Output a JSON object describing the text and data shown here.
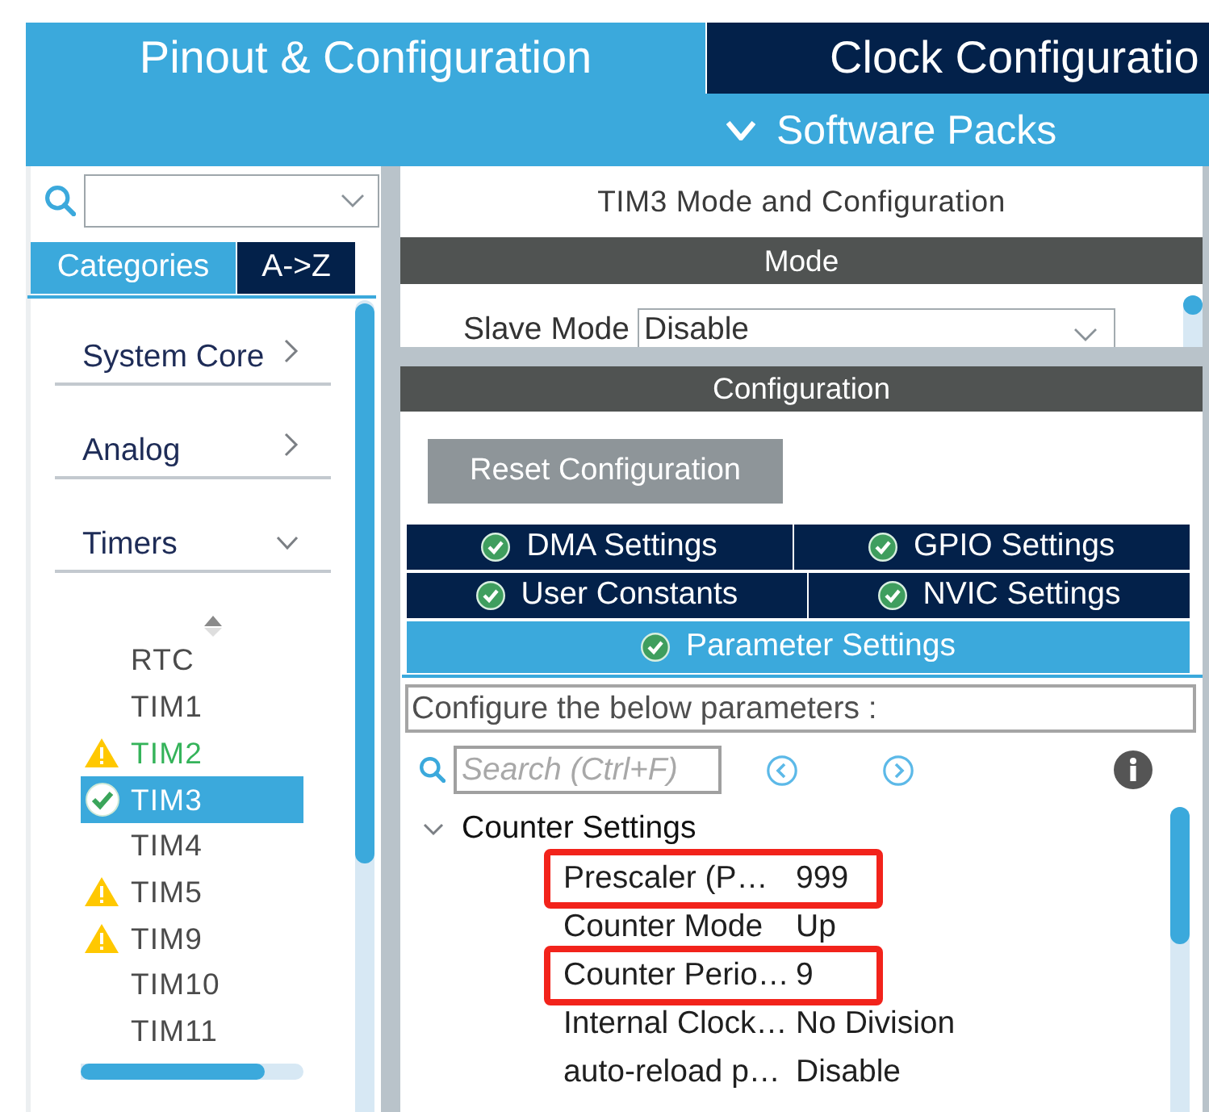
{
  "header": {
    "tabs": [
      {
        "label": "Pinout & Configuration",
        "selected": true
      },
      {
        "label": "Clock Configuratio",
        "selected": false
      }
    ],
    "software_packs": "Software Packs"
  },
  "sidebar": {
    "view_tabs": [
      {
        "label": "Categories",
        "selected": true
      },
      {
        "label": "A->Z",
        "selected": false
      }
    ],
    "categories": [
      {
        "label": "System Core",
        "expanded": false
      },
      {
        "label": "Analog",
        "expanded": false
      },
      {
        "label": "Timers",
        "expanded": true,
        "children": [
          {
            "label": "RTC",
            "kind": "plain",
            "selected": false
          },
          {
            "label": "TIM1",
            "kind": "plain",
            "selected": false
          },
          {
            "label": "TIM2",
            "kind": "partial",
            "selected": false
          },
          {
            "label": "TIM3",
            "kind": "done",
            "selected": true
          },
          {
            "label": "TIM4",
            "kind": "plain",
            "selected": false
          },
          {
            "label": "TIM5",
            "kind": "warning",
            "selected": false
          },
          {
            "label": "TIM9",
            "kind": "warning",
            "selected": false
          },
          {
            "label": "TIM10",
            "kind": "plain",
            "selected": false
          },
          {
            "label": "TIM11",
            "kind": "plain",
            "selected": false
          }
        ]
      }
    ]
  },
  "mode": {
    "title": "TIM3 Mode and Configuration",
    "header": "Mode",
    "fields": [
      {
        "label": "Slave Mode",
        "value": "Disable"
      }
    ]
  },
  "configuration": {
    "header": "Configuration",
    "reset_button": "Reset Configuration",
    "tabs": [
      {
        "label": "DMA Settings",
        "selected": false
      },
      {
        "label": "GPIO Settings",
        "selected": false
      },
      {
        "label": "User Constants",
        "selected": false
      },
      {
        "label": "NVIC Settings",
        "selected": false
      },
      {
        "label": "Parameter Settings",
        "selected": true
      }
    ],
    "hint": "Configure the below parameters :",
    "search": {
      "placeholder": "Search (Ctrl+F)"
    },
    "groups": [
      {
        "label": "Counter Settings",
        "expanded": true,
        "params": [
          {
            "name": "Prescaler (P…",
            "value": "999",
            "highlighted": true
          },
          {
            "name": "Counter Mode",
            "value": "Up",
            "highlighted": false
          },
          {
            "name": "Counter Perio…",
            "value": "9",
            "highlighted": true
          },
          {
            "name": "Internal Clock…",
            "value": "No Division",
            "highlighted": false
          },
          {
            "name": "auto-reload p…",
            "value": "Disable",
            "highlighted": false
          }
        ]
      }
    ]
  }
}
